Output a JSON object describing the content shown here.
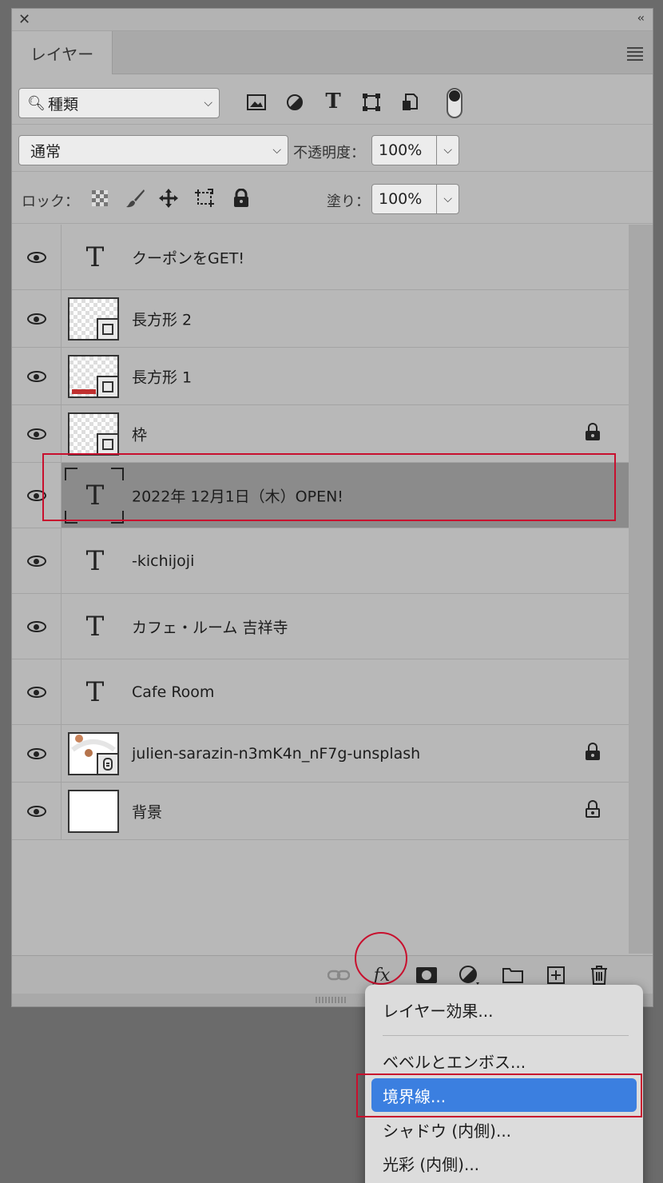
{
  "panel": {
    "tab_label": "レイヤー",
    "filter": {
      "label": "種類"
    },
    "blend": {
      "mode": "通常",
      "opacity_label": "不透明度：",
      "opacity_value": "100%"
    },
    "lock": {
      "label": "ロック：",
      "fill_label": "塗り：",
      "fill_value": "100%"
    }
  },
  "layers": [
    {
      "name": "クーポンをGET!",
      "kind": "text",
      "locked": false
    },
    {
      "name": "長方形 2",
      "kind": "shape",
      "locked": false
    },
    {
      "name": "長方形 1",
      "kind": "shape",
      "locked": false
    },
    {
      "name": "枠",
      "kind": "shape",
      "locked": true
    },
    {
      "name": "2022年 12月1日（木）OPEN!",
      "kind": "text",
      "locked": false,
      "selected": true
    },
    {
      "name": "-kichijoji",
      "kind": "text",
      "locked": false
    },
    {
      "name": "カフェ・ルーム 吉祥寺",
      "kind": "text",
      "locked": false
    },
    {
      "name": "Cafe Room",
      "kind": "text",
      "locked": false
    },
    {
      "name": "julien-sarazin-n3mK4n_nF7g-unsplash",
      "kind": "smart-object",
      "locked": true
    },
    {
      "name": "背景",
      "kind": "background",
      "locked": true
    }
  ],
  "bottom_bar": {
    "fx_label": "fx"
  },
  "fx_menu": {
    "items": [
      "レイヤー効果...",
      "ベベルとエンボス...",
      "境界線...",
      "シャドウ (内側)...",
      "光彩 (内側)..."
    ],
    "highlighted_index": 2
  },
  "colors": {
    "highlight": "#3b7fe0",
    "annotation": "#c8102e",
    "selected_row": "#8b8b8b"
  }
}
